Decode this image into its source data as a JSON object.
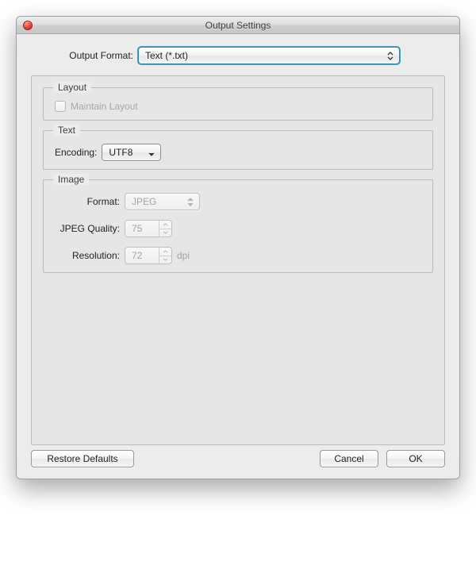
{
  "window": {
    "title": "Output Settings"
  },
  "outputFormat": {
    "label": "Output Format:",
    "value": "Text (*.txt)"
  },
  "layout": {
    "legend": "Layout",
    "maintain": {
      "label": "Maintain Layout",
      "checked": false
    }
  },
  "text": {
    "legend": "Text",
    "encoding": {
      "label": "Encoding:",
      "value": "UTF8"
    }
  },
  "image": {
    "legend": "Image",
    "format": {
      "label": "Format:",
      "value": "JPEG"
    },
    "quality": {
      "label": "JPEG Quality:",
      "value": "75"
    },
    "resolution": {
      "label": "Resolution:",
      "value": "72",
      "unit": "dpi"
    }
  },
  "buttons": {
    "restore": "Restore Defaults",
    "cancel": "Cancel",
    "ok": "OK"
  }
}
